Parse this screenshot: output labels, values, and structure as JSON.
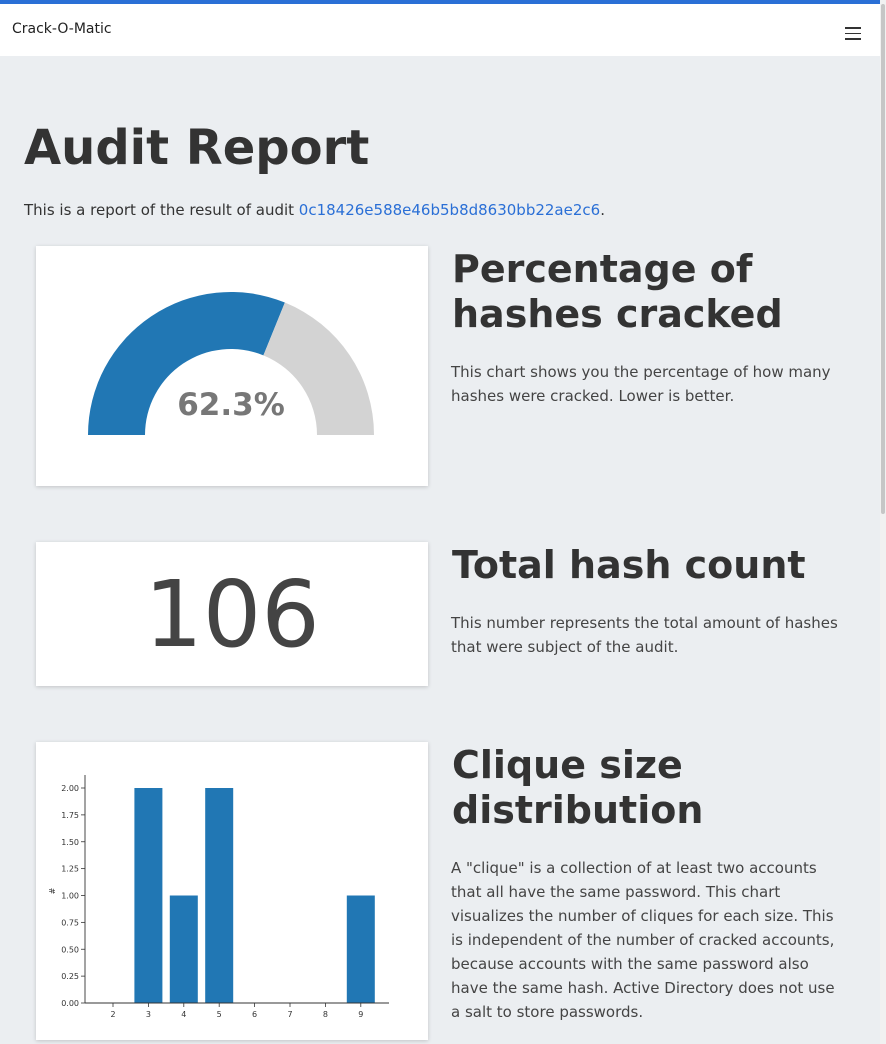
{
  "navbar": {
    "brand": "Crack-O-Matic"
  },
  "header": {
    "title": "Audit Report",
    "intro_prefix": "This is a report of the result of audit ",
    "audit_id": "0c18426e588e46b5b8d8630bb22ae2c6",
    "intro_suffix": "."
  },
  "sections": {
    "cracked": {
      "title": "Percentage of hashes cracked",
      "description": "This chart shows you the percentage of how many hashes were cracked. Lower is better.",
      "gauge_label": "62.3%",
      "percent": 62.3,
      "colors": {
        "filled": "#2177b4",
        "remaining": "#d3d3d3",
        "label": "#777777"
      }
    },
    "total": {
      "title": "Total hash count",
      "description": "This number represents the total amount of hashes that were subject of the audit.",
      "value": "106"
    },
    "cliques": {
      "title": "Clique size distribution",
      "description": "A \"clique\" is a collection of at least two accounts that all have the same password. This chart visualizes the number of cliques for each size. This is independent of the number of cracked accounts, because accounts with the same password also have the same hash. Active Directory does not use a salt to store passwords."
    }
  },
  "chart_data": [
    {
      "type": "pie",
      "title": "",
      "values": [
        62.3,
        37.7
      ],
      "colors": [
        "#2177b4",
        "#d3d3d3"
      ],
      "center_label": "62.3%"
    },
    {
      "type": "bar",
      "title": "",
      "xlabel": "",
      "ylabel": "#",
      "categories": [
        "2",
        "3",
        "4",
        "5",
        "6",
        "7",
        "8",
        "9"
      ],
      "values": [
        0,
        2,
        1,
        2,
        0,
        0,
        0,
        1
      ],
      "ylim": [
        0,
        2.0
      ],
      "yticks": [
        "0.00",
        "0.25",
        "0.50",
        "0.75",
        "1.00",
        "1.25",
        "1.50",
        "1.75",
        "2.00"
      ],
      "grid": false,
      "color": "#2177b4"
    }
  ]
}
